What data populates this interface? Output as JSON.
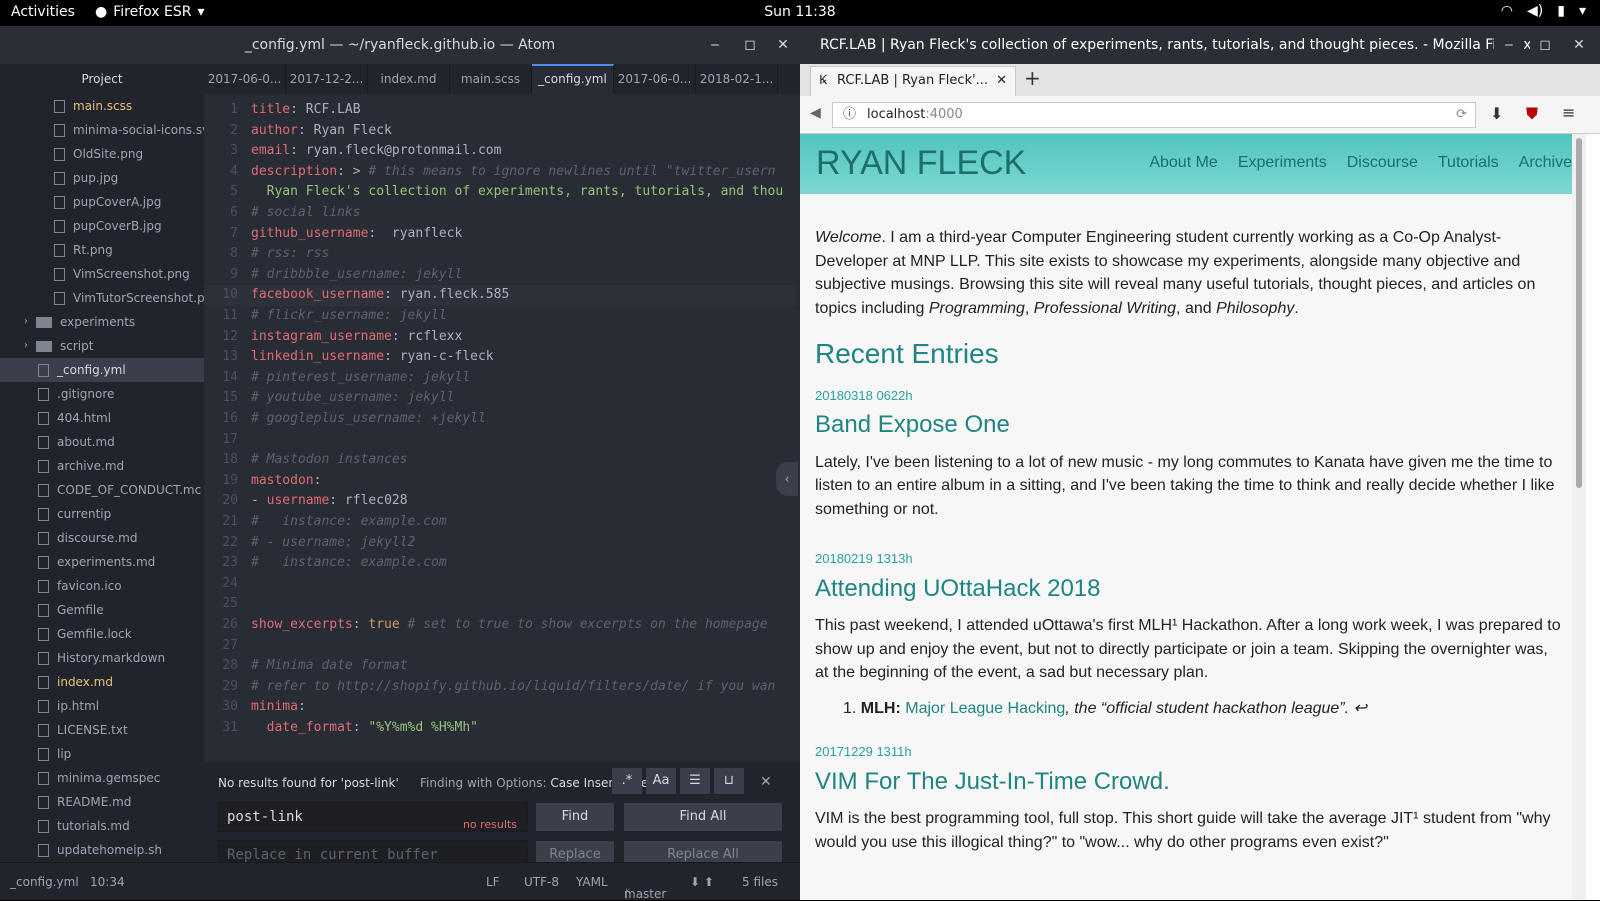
{
  "sysbar": {
    "activities": "Activities",
    "app": "Firefox ESR",
    "clock": "Sun 11:38"
  },
  "atom": {
    "title": "_config.yml — ~/ryanfleck.github.io — Atom",
    "tree_header": "Project",
    "tree": [
      {
        "name": "main.scss",
        "kind": "file",
        "indent": 1,
        "mod": true
      },
      {
        "name": "minima-social-icons.sv",
        "kind": "file",
        "indent": 1
      },
      {
        "name": "OldSite.png",
        "kind": "image",
        "indent": 1
      },
      {
        "name": "pup.jpg",
        "kind": "image",
        "indent": 1
      },
      {
        "name": "pupCoverA.jpg",
        "kind": "image",
        "indent": 1
      },
      {
        "name": "pupCoverB.jpg",
        "kind": "image",
        "indent": 1
      },
      {
        "name": "Rt.png",
        "kind": "image",
        "indent": 1
      },
      {
        "name": "VimScreenshot.png",
        "kind": "image",
        "indent": 1
      },
      {
        "name": "VimTutorScreenshot.pr",
        "kind": "image",
        "indent": 1
      },
      {
        "name": "experiments",
        "kind": "folder",
        "indent": 0
      },
      {
        "name": "script",
        "kind": "folder",
        "indent": 0
      },
      {
        "name": "_config.yml",
        "kind": "file",
        "indent": 0,
        "sel": true
      },
      {
        "name": ".gitignore",
        "kind": "file",
        "indent": 0
      },
      {
        "name": "404.html",
        "kind": "file",
        "indent": 0
      },
      {
        "name": "about.md",
        "kind": "file",
        "indent": 0
      },
      {
        "name": "archive.md",
        "kind": "file",
        "indent": 0
      },
      {
        "name": "CODE_OF_CONDUCT.mc",
        "kind": "file",
        "indent": 0
      },
      {
        "name": "currentip",
        "kind": "file",
        "indent": 0
      },
      {
        "name": "discourse.md",
        "kind": "file",
        "indent": 0
      },
      {
        "name": "experiments.md",
        "kind": "file",
        "indent": 0
      },
      {
        "name": "favicon.ico",
        "kind": "image",
        "indent": 0
      },
      {
        "name": "Gemfile",
        "kind": "file",
        "indent": 0
      },
      {
        "name": "Gemfile.lock",
        "kind": "file",
        "indent": 0
      },
      {
        "name": "History.markdown",
        "kind": "file",
        "indent": 0
      },
      {
        "name": "index.md",
        "kind": "file",
        "indent": 0,
        "mod": true
      },
      {
        "name": "ip.html",
        "kind": "file",
        "indent": 0
      },
      {
        "name": "LICENSE.txt",
        "kind": "file",
        "indent": 0
      },
      {
        "name": "lip",
        "kind": "file",
        "indent": 0
      },
      {
        "name": "minima.gemspec",
        "kind": "file",
        "indent": 0
      },
      {
        "name": "README.md",
        "kind": "file",
        "indent": 0
      },
      {
        "name": "tutorials.md",
        "kind": "file",
        "indent": 0
      },
      {
        "name": "updatehomeip.sh",
        "kind": "file",
        "indent": 0
      }
    ],
    "tabs": [
      "2017-06-0...",
      "2017-12-2...",
      "index.md",
      "main.scss",
      "_config.yml",
      "2017-06-0...",
      "2018-02-1..."
    ],
    "active_tab": 4,
    "current_line": 10,
    "code": [
      [
        [
          "k",
          "title"
        ],
        [
          "",
          "- RCF.LAB"
        ]
      ],
      [
        [
          "k",
          "author"
        ],
        [
          "",
          ": Ryan Fleck"
        ]
      ],
      [
        [
          "k",
          "email"
        ],
        [
          "",
          ": ryan.fleck@protonmail.com"
        ]
      ],
      [
        [
          "k",
          "description"
        ],
        [
          "",
          ": > "
        ],
        [
          "c",
          "# this means to ignore newlines until \"twitter_usern"
        ]
      ],
      [
        [
          "s",
          "  Ryan Fleck's collection of experiments, rants, tutorials, and thou"
        ]
      ],
      [
        [
          "c",
          "# social links"
        ]
      ],
      [
        [
          "k",
          "github_username"
        ],
        [
          "",
          ":  ryanfleck"
        ]
      ],
      [
        [
          "c",
          "# rss: rss"
        ]
      ],
      [
        [
          "c",
          "# dribbble_username: jekyll"
        ]
      ],
      [
        [
          "k",
          "facebook_username"
        ],
        [
          "",
          ": ryan.fleck.585"
        ]
      ],
      [
        [
          "c",
          "# flickr_username: jekyll"
        ]
      ],
      [
        [
          "k",
          "instagram_username"
        ],
        [
          "",
          ": rcflexx"
        ]
      ],
      [
        [
          "k",
          "linkedin_username"
        ],
        [
          "",
          ": ryan-c-fleck"
        ]
      ],
      [
        [
          "c",
          "# pinterest_username: jekyll"
        ]
      ],
      [
        [
          "c",
          "# youtube_username: jekyll"
        ]
      ],
      [
        [
          "c",
          "# googleplus_username: +jekyll"
        ]
      ],
      [],
      [
        [
          "c",
          "# Mastodon instances"
        ]
      ],
      [
        [
          "k",
          "mastodon"
        ],
        [
          "",
          ":"
        ]
      ],
      [
        [
          "",
          "- "
        ],
        [
          "k",
          "username"
        ],
        [
          "",
          ": rflec028"
        ]
      ],
      [
        [
          "c",
          "#   instance: example.com"
        ]
      ],
      [
        [
          "c",
          "# - username: jekyll2"
        ]
      ],
      [
        [
          "c",
          "#   instance: example.com"
        ]
      ],
      [],
      [],
      [
        [
          "k",
          "show_excerpts"
        ],
        [
          "",
          ": "
        ],
        [
          "b",
          "true"
        ],
        [
          "c",
          " # set to true to show excerpts on the homepage"
        ]
      ],
      [],
      [
        [
          "c",
          "# Minima date format"
        ]
      ],
      [
        [
          "c",
          "# refer to http://shopify.github.io/liquid/filters/date/ if you wan"
        ]
      ],
      [
        [
          "k",
          "minima"
        ],
        [
          "",
          ":"
        ]
      ],
      [
        [
          "k",
          "  date_format"
        ],
        [
          "",
          ": "
        ],
        [
          "s",
          "\"%Y%m%d %H%Mh\""
        ]
      ]
    ],
    "find": {
      "message": "No results found for 'post-link'",
      "options_label": "Finding with Options:",
      "options_value": "Case Insensitive",
      "find_value": "post-link",
      "no_results": "no results",
      "replace_placeholder": "Replace in current buffer",
      "find_btn": "Find",
      "find_all_btn": "Find All",
      "replace_btn": "Replace",
      "replace_all_btn": "Replace All"
    },
    "status": {
      "file": "_config.yml",
      "cursor": "10:34",
      "eol": "LF",
      "encoding": "UTF-8",
      "grammar": "YAML",
      "branch": "master",
      "files": "5 files"
    }
  },
  "firefox": {
    "title": "RCF.LAB | Ryan Fleck's collection of experiments, rants, tutorials, and thought pieces. - Mozilla Firefox",
    "tab_label": "RCF.LAB | Ryan Fleck'...",
    "url_host": "localhost",
    "url_port": ":4000",
    "site": {
      "brand": "RYAN FLECK",
      "nav": [
        "About Me",
        "Experiments",
        "Discourse",
        "Tutorials",
        "Archive"
      ],
      "intro_welcome": "Welcome",
      "intro": ". I am a third-year Computer Engineering student currently working as a Co-Op Analyst-Developer at MNP LLP. This site exists to showcase my experiments, alongside many objective and subjective musings. Browsing this site will reveal many useful tutorials, thought pieces, and articles on topics including ",
      "intro_t1": "Programming",
      "intro_t2": "Professional Writing",
      "intro_and": ", and ",
      "intro_t3": "Philosophy",
      "recent": "Recent Entries",
      "posts": [
        {
          "date": "20180318 0622h",
          "title": "Band Expose One",
          "excerpt": "Lately, I've been listening to a lot of new music - my long commutes to Kanata have given me the time to listen to an entire album in a sitting, and I've been taking the time to think and really decide whether I like something or not."
        },
        {
          "date": "20180219 1313h",
          "title": "Attending UOttaHack 2018",
          "excerpt": "This past weekend, I attended uOttawa's first MLH¹ Hackathon. After a long work week, I was prepared to show up and enjoy the event, but not to directly participate or join a team. Skipping the overnighter was, at the beginning of the event, a sad but necessary plan."
        },
        {
          "date": "20171229 1311h",
          "title": "VIM For The Just-In-Time Crowd.",
          "excerpt": "VIM is the best programming tool, full stop. This short guide will take the average JIT¹ student from \"why would you use this illogical thing?\" to \"wow... why do other programs even exist?\""
        }
      ],
      "footnote_label": "MLH:",
      "footnote_link": "Major League Hacking",
      "footnote_rest": ", the “official student hackathon league”. ↩"
    }
  }
}
